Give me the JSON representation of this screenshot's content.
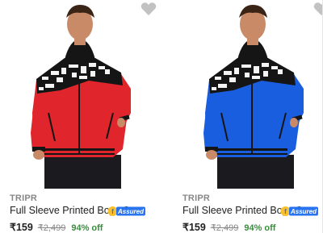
{
  "products": [
    {
      "brand": "TRIPR",
      "title": "Full Sleeve Printed Boys C...",
      "assured_label": "Assured",
      "price": "₹159",
      "mrp": "₹2,499",
      "discount": "94% off",
      "hoodie_color": "#e0262c",
      "wishlist_icon": "heart-icon"
    },
    {
      "brand": "TRIPR",
      "title": "Full Sleeve Printed Boys C...",
      "assured_label": "Assured",
      "price": "₹159",
      "mrp": "₹2,499",
      "discount": "94% off",
      "hoodie_color": "#1a5ee0",
      "wishlist_icon": "heart-icon"
    }
  ],
  "colors": {
    "brand_text": "#878787",
    "discount_green": "#388e3c",
    "assured_blue": "#2874f0",
    "heart_gray": "#c2c2c2"
  }
}
